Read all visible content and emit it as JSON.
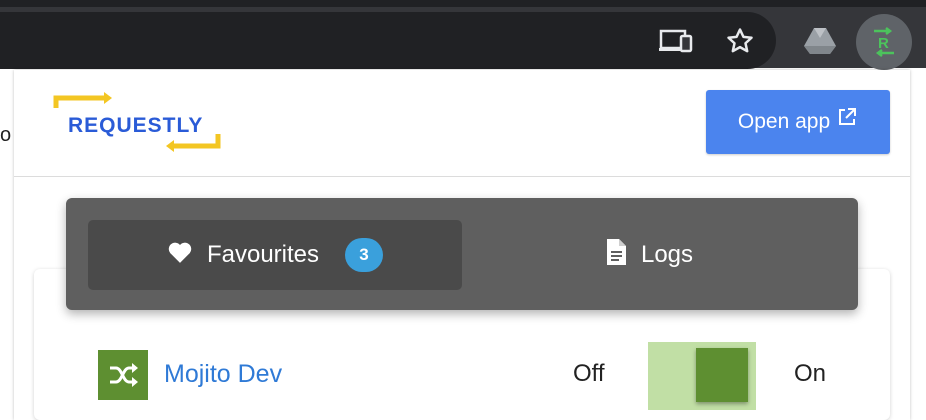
{
  "browser": {
    "toolbar_icons": [
      "cast-icon",
      "star-icon",
      "drive-icon",
      "requestly-extension-icon"
    ],
    "page_edge_text": "o"
  },
  "popup": {
    "logo_text": "REQUESTLY",
    "open_app_label": "Open app",
    "tabs": [
      {
        "label": "Favourites",
        "icon": "heart-icon",
        "badge": "3",
        "active": true
      },
      {
        "label": "Logs",
        "icon": "document-icon",
        "active": false
      }
    ],
    "rules": [
      {
        "name": "Mojito Dev",
        "icon": "shuffle-icon",
        "toggle_off_label": "Off",
        "toggle_on_label": "On",
        "enabled": true
      }
    ]
  },
  "colors": {
    "chrome_bg": "#35363a",
    "omnibox_bg": "#202124",
    "brand_blue": "#2a5bd7",
    "brand_yellow": "#f3c623",
    "button_blue": "#4b84ee",
    "tab_bar": "#5f5f5f",
    "tab_active": "#4a4a4a",
    "badge": "#3aa0dc",
    "rule_link": "#2f7ad6",
    "toggle_on": "#5e8f31",
    "toggle_track": "#c1dfa5"
  }
}
